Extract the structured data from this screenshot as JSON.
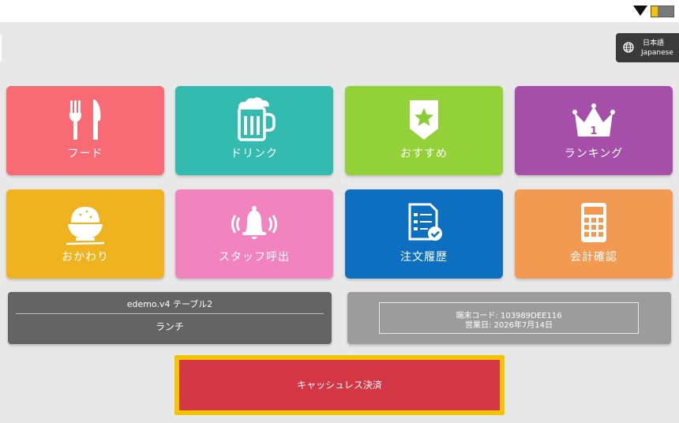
{
  "status_bar": {
    "wifi_icon": "wifi-icon",
    "battery_level": 0.3,
    "battery_color": "#f5c400"
  },
  "language": {
    "line1": "日本語",
    "line2": "Japanese",
    "icon": "globe-icon"
  },
  "menu_tiles": [
    {
      "label": "フード",
      "icon": "fork-knife-icon",
      "color": "#f96b74"
    },
    {
      "label": "ドリンク",
      "icon": "beer-mug-icon",
      "color": "#33bbb0"
    },
    {
      "label": "おすすめ",
      "icon": "star-badge-icon",
      "color": "#92d138"
    },
    {
      "label": "ランキング",
      "icon": "crown-icon",
      "color": "#a64fa8"
    },
    {
      "label": "おかわり",
      "icon": "rice-bowl-icon",
      "color": "#eeb31e"
    },
    {
      "label": "スタッフ呼出",
      "icon": "bell-icon",
      "color": "#f183bf"
    },
    {
      "label": "注文履歴",
      "icon": "order-history-icon",
      "color": "#0d6fc0"
    },
    {
      "label": "会計確認",
      "icon": "calculator-icon",
      "color": "#f29a52"
    }
  ],
  "table_info": {
    "store_table": "edemo.v4  テーブル2",
    "menu_type": "ランチ"
  },
  "terminal_info": {
    "code_line": "端末コード: 103989DEE116",
    "date_line": "営業日: 2026年7月14日"
  },
  "payment": {
    "label": "キャッシュレス決済"
  }
}
